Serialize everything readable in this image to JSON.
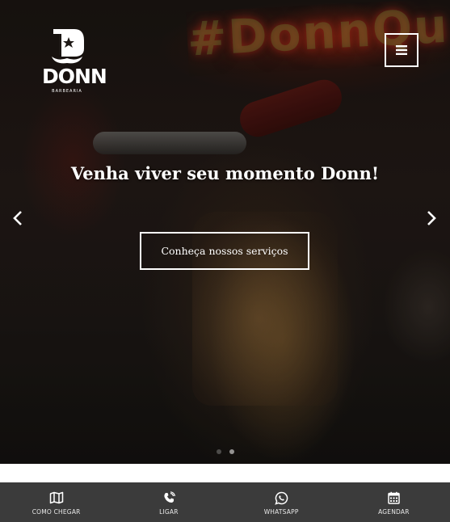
{
  "brand": {
    "name": "DONN",
    "subtitle": "BARBEARIA"
  },
  "hero": {
    "background_sign": "#DonnQu",
    "headline": "Venha viver seu momento Donn!",
    "cta_label": "Conheça nossos serviços",
    "slides_count": 2,
    "active_slide": 2
  },
  "icons": {
    "menu": "hamburger-menu-icon",
    "prev": "chevron-left-icon",
    "next": "chevron-right-icon"
  },
  "bottom_nav": [
    {
      "label": "COMO CHEGAR",
      "icon": "map-icon"
    },
    {
      "label": "LIGAR",
      "icon": "phone-icon"
    },
    {
      "label": "WHATSAPP",
      "icon": "whatsapp-icon"
    },
    {
      "label": "AGENDAR",
      "icon": "calendar-icon"
    }
  ],
  "colors": {
    "bottom_bar": "#3b3b3b",
    "text": "#ffffff"
  }
}
